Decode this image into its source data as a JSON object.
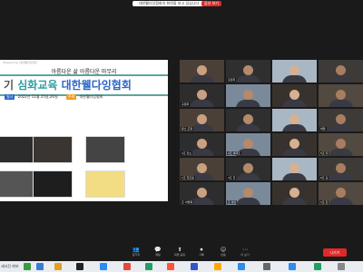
{
  "window": {
    "notice_text": "대한웰다잉협회의 화면을 보고 있습니다",
    "stop_label": "옵션 보기"
  },
  "slide": {
    "tiny_caption": "Powered by 대한웰다잉협회",
    "line1": "아름다운 삶 아름다운 마무리",
    "title_part1": "기",
    "title_part2": "심화교육",
    "title_part3": "대한웰다잉협회",
    "date_tag": "일시",
    "date_text": "2022년 11월 25일,26일",
    "host_tag": "주최",
    "host_text": "대한웰다잉협회"
  },
  "participants": [
    {
      "name": ""
    },
    {
      "name": "홍정희"
    },
    {
      "name": ""
    },
    {
      "name": ""
    },
    {
      "name": "홍정희"
    },
    {
      "name": ""
    },
    {
      "name": ""
    },
    {
      "name": ""
    },
    {
      "name": "유스 조정"
    },
    {
      "name": ""
    },
    {
      "name": ""
    },
    {
      "name": "박형"
    },
    {
      "name": "4조 민소"
    },
    {
      "name": "4조 이대조"
    },
    {
      "name": ""
    },
    {
      "name": "5조 자"
    },
    {
      "name": "1조 한조윤"
    },
    {
      "name": "4조 한"
    },
    {
      "name": ""
    },
    {
      "name": "6조 김"
    },
    {
      "name": "조 서명재"
    },
    {
      "name": "조 정인"
    },
    {
      "name": ""
    },
    {
      "name": "1조 진"
    }
  ],
  "toolbar": {
    "items": [
      {
        "icon": "👥",
        "label": "참가자"
      },
      {
        "icon": "💬",
        "label": "채팅"
      },
      {
        "icon": "⬆",
        "label": "화면 공유"
      },
      {
        "icon": "⏺",
        "label": "기록"
      },
      {
        "icon": "☺",
        "label": "반응"
      },
      {
        "icon": "⋯",
        "label": "더 보기"
      }
    ],
    "leave_label": "나가기"
  },
  "taskbar": {
    "text": "세사진 파보"
  },
  "colors": {
    "accent_teal": "#2f9ea0",
    "accent_blue": "#2b66c8",
    "leave_red": "#e02828"
  }
}
